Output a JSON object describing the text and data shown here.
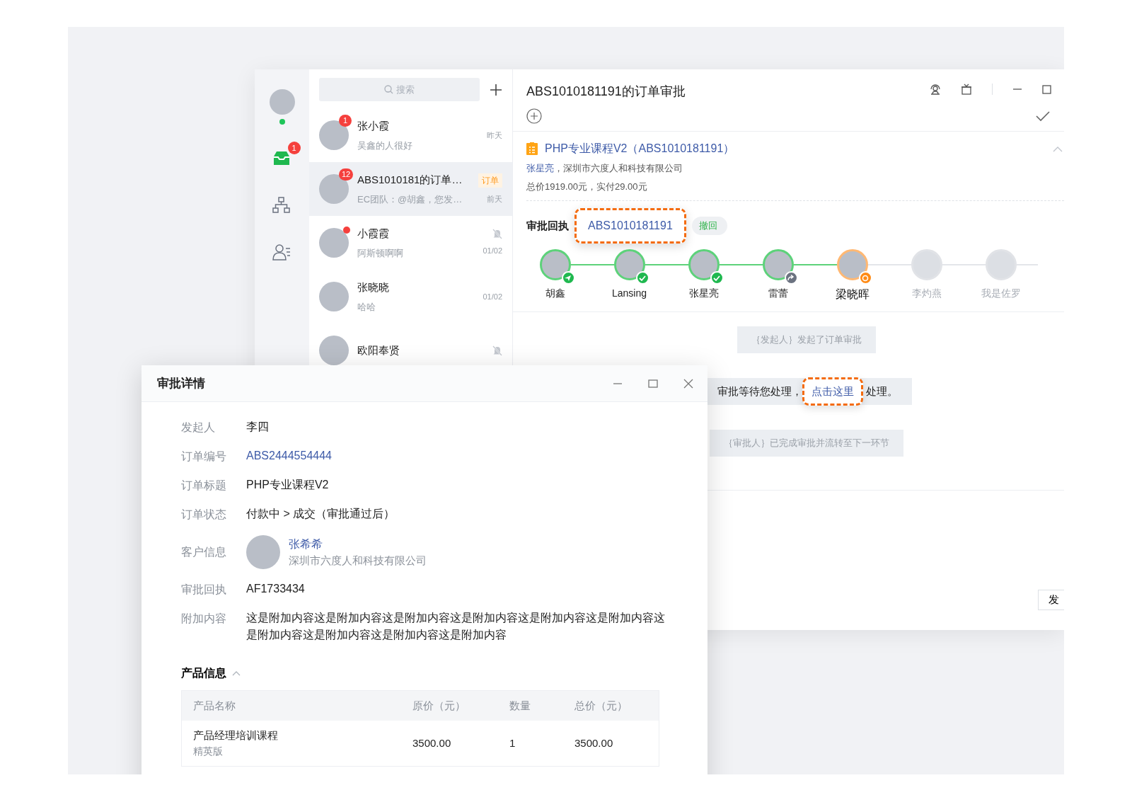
{
  "sidebar": {
    "online": true,
    "nav": [
      {
        "kind": "inbox",
        "badge": "1",
        "selected": true
      },
      {
        "kind": "org",
        "selected": false
      },
      {
        "kind": "contacts",
        "selected": false
      }
    ]
  },
  "search": {
    "placeholder": "搜索"
  },
  "chats": [
    {
      "name": "张小霞",
      "preview": "吴鑫的人很好",
      "time": "昨天",
      "badge": "1",
      "unread_dot": false,
      "muted": false,
      "selected": false
    },
    {
      "name": "ABS1010181的订单…",
      "preview": "EC团队：@胡鑫，您发…",
      "time": "前天",
      "badge": "12",
      "tag": "订单",
      "unread_dot": false,
      "muted": false,
      "selected": true
    },
    {
      "name": "小霞霞",
      "preview": "阿斯顿啊啊",
      "time": "01/02",
      "unread_dot": true,
      "muted": true,
      "selected": false
    },
    {
      "name": "张晓晓",
      "preview": "哈哈",
      "time": "01/02",
      "unread_dot": false,
      "muted": false,
      "selected": false
    },
    {
      "name": "欧阳奉贤",
      "unread_dot": false,
      "muted": true,
      "selected": false
    }
  ],
  "conversation": {
    "title": "ABS1010181191的订单审批",
    "order": {
      "title": "PHP专业课程V2（ABS1010181191）",
      "contact": "张星亮",
      "company": "，深圳市六度人和科技有限公司",
      "price": "总价1919.00元，实付29.00元",
      "expanded": true
    },
    "receipt": {
      "label": "审批回执",
      "value": "ABS1010181191",
      "action": "撤回",
      "highlighted": true
    },
    "steps": [
      {
        "name": "胡鑫",
        "kind": "sent"
      },
      {
        "name": "Lansing",
        "kind": "approved"
      },
      {
        "name": "张星亮",
        "kind": "approved"
      },
      {
        "name": "雷蕾",
        "kind": "forwarded"
      },
      {
        "name": "梁晓晖",
        "kind": "current"
      },
      {
        "name": "李灼燕",
        "kind": "pending"
      },
      {
        "name": "我是佐罗",
        "kind": "pending"
      }
    ],
    "messages": [
      {
        "kind": "system",
        "text": "｛发起人｝发起了订单审批"
      },
      {
        "kind": "action",
        "text": "审批等待您处理，",
        "link": "点击这里",
        "after": " 处理。",
        "highlighted": true
      },
      {
        "kind": "system",
        "text": "｛审批人｝已完成审批并流转至下一环节"
      }
    ],
    "send_button": "发"
  },
  "dialog": {
    "title": "审批详情",
    "fields": [
      {
        "kind": "text",
        "label": "发起人",
        "value": "李四"
      },
      {
        "kind": "link",
        "label": "订单编号",
        "value": "ABS2444554444"
      },
      {
        "kind": "text",
        "label": "订单标题",
        "value": "PHP专业课程V2"
      },
      {
        "kind": "text",
        "label": "订单状态",
        "value": "付款中 > 成交（审批通过后）"
      },
      {
        "kind": "customer",
        "label": "客户信息",
        "value": "张希希",
        "company": "深圳市六度人和科技有限公司"
      },
      {
        "kind": "text",
        "label": "审批回执",
        "value": "AF1733434"
      },
      {
        "kind": "text",
        "label": "附加内容",
        "value": "这是附加内容这是附加内容这是附加内容这是附加内容这是附加内容这是附加内容这是附加内容这是附加内容这是附加内容这是附加内容"
      }
    ],
    "section": {
      "title": "产品信息",
      "expanded": true
    },
    "table": {
      "columns": [
        "产品名称",
        "原价（元）",
        "数量",
        "总价（元）"
      ],
      "rows": [
        {
          "name": "产品经理培训课程",
          "variant": "精英版",
          "price": "3500.00",
          "qty": "1",
          "total": "3500.00"
        }
      ]
    }
  }
}
